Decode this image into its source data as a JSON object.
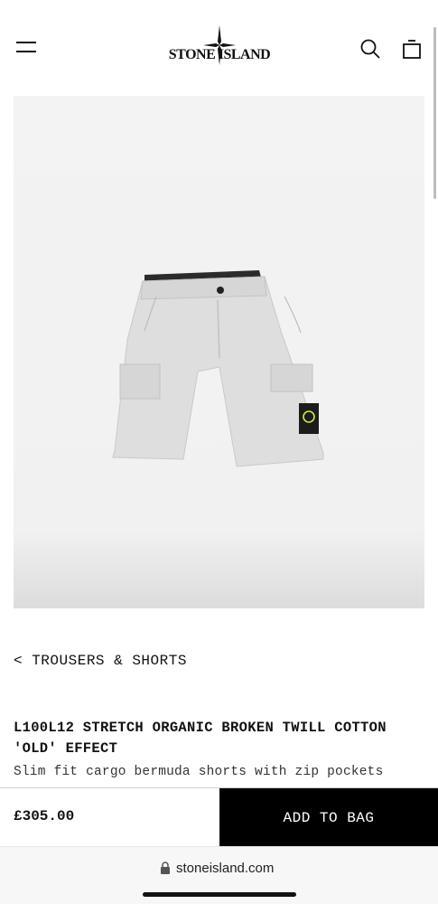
{
  "header": {
    "brand": "STONE ISLAND",
    "icons": [
      "hamburger-menu-icon",
      "compass-rose-logo",
      "search-icon",
      "shopping-bag-icon"
    ]
  },
  "product": {
    "breadcrumb": "< TROUSERS & SHORTS",
    "title": "L100L12 STRETCH ORGANIC BROKEN TWILL COTTON 'OLD' EFFECT",
    "description": "Slim fit cargo bermuda shorts with zip pockets",
    "price": "£305.00",
    "add_to_bag_label": "ADD TO BAG",
    "colors": {
      "shorts": "#dedede",
      "background": "#f2f2f2",
      "badge_accent": "#cfe84a"
    }
  },
  "browser": {
    "url": "stoneisland.com"
  }
}
